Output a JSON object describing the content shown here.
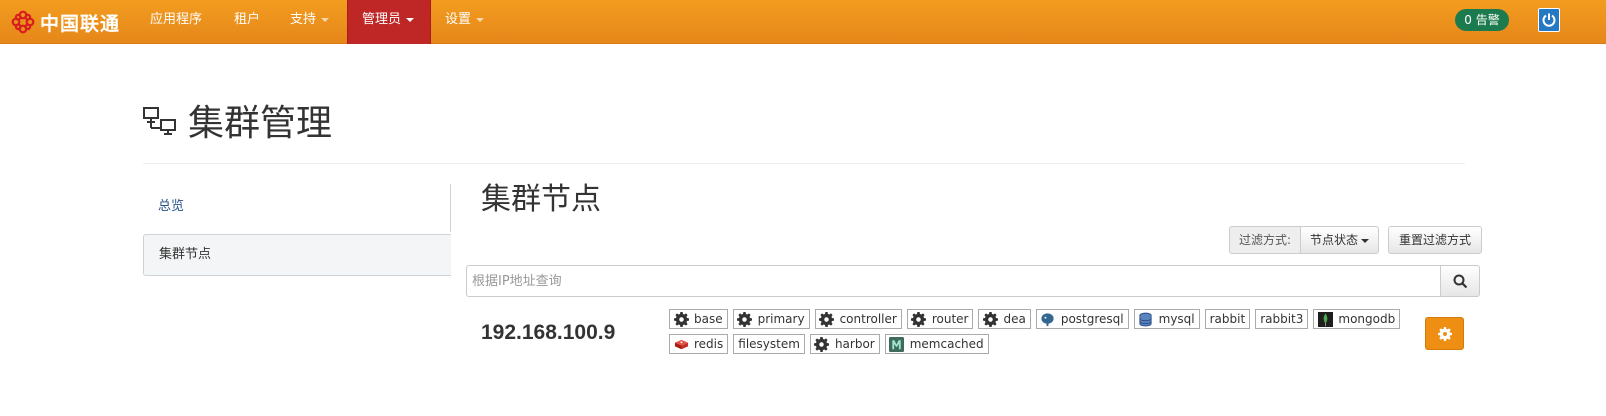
{
  "brand": {
    "name": "中国联通"
  },
  "nav": {
    "items": [
      {
        "label": "应用程序",
        "has_dropdown": false
      },
      {
        "label": "租户",
        "has_dropdown": false
      },
      {
        "label": "支持",
        "has_dropdown": true
      },
      {
        "label": "管理员",
        "has_dropdown": true,
        "active": true
      },
      {
        "label": "设置",
        "has_dropdown": true
      }
    ],
    "alerts_label": "0 告警"
  },
  "page": {
    "title": "集群管理",
    "icon": "cluster-icon"
  },
  "sidebar": {
    "items": [
      {
        "label": "总览",
        "active": false
      },
      {
        "label": "集群节点",
        "active": true
      }
    ]
  },
  "main": {
    "title": "集群节点",
    "filter": {
      "label": "过滤方式:",
      "button": "节点状态",
      "reset": "重置过滤方式"
    },
    "search": {
      "placeholder": "根据IP地址查询"
    },
    "node": {
      "ip": "192.168.100.9",
      "tags": [
        {
          "label": "base",
          "icon": "gear-icon"
        },
        {
          "label": "primary",
          "icon": "gear-icon"
        },
        {
          "label": "controller",
          "icon": "gear-icon"
        },
        {
          "label": "router",
          "icon": "gear-icon"
        },
        {
          "label": "dea",
          "icon": "gear-icon"
        },
        {
          "label": "postgresql",
          "icon": "postgresql-icon"
        },
        {
          "label": "mysql",
          "icon": "database-icon"
        },
        {
          "label": "rabbit",
          "icon": ""
        },
        {
          "label": "rabbit3",
          "icon": ""
        },
        {
          "label": "mongodb",
          "icon": "mongodb-icon"
        },
        {
          "label": "redis",
          "icon": "redis-icon"
        },
        {
          "label": "filesystem",
          "icon": ""
        },
        {
          "label": "harbor",
          "icon": "gear-icon"
        },
        {
          "label": "memcached",
          "icon": "memcached-icon"
        }
      ]
    }
  },
  "colors": {
    "navbar": "#ee9320",
    "active_nav": "#bf2626",
    "badge": "#1c7b4e",
    "action_button": "#ee8f14"
  }
}
